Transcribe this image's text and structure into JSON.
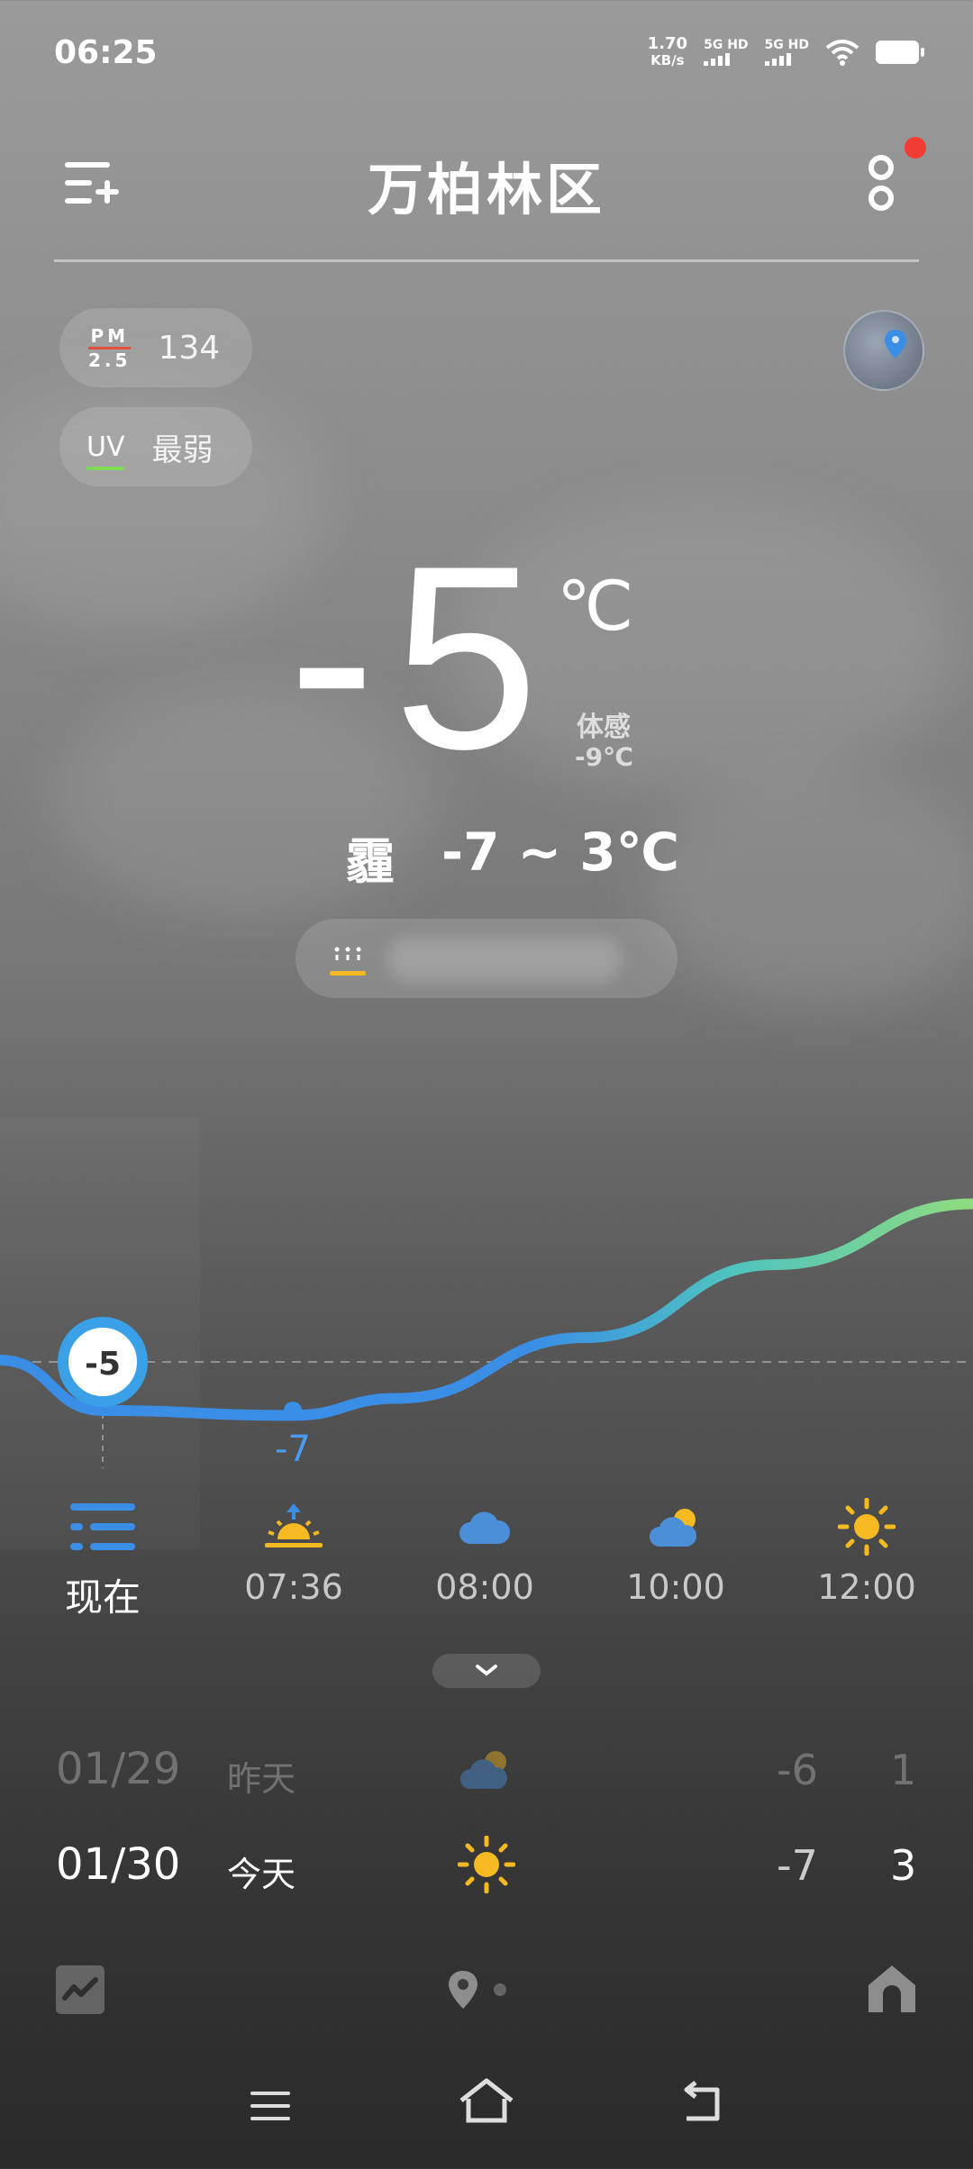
{
  "status_bar": {
    "time": "06:25",
    "net_speed_value": "1.70",
    "net_speed_unit": "KB/s",
    "sim1_label": "5G HD",
    "sim2_label": "5G HD"
  },
  "header": {
    "city": "万柏林区"
  },
  "air": {
    "pm_label_top": "PM",
    "pm_label_bottom": "2.5",
    "pm_value": "134",
    "uv_label": "UV",
    "uv_value": "最弱"
  },
  "current": {
    "temperature": "-5",
    "unit": "℃",
    "feels_like_label": "体感",
    "feels_like_value": "-9℃",
    "condition": "霾",
    "range": "-7 ~ 3℃"
  },
  "chart_data": {
    "type": "line",
    "now_marker": "-5",
    "min_label": "-7",
    "values": [
      -5,
      -7,
      -7.2,
      -6.5,
      -4,
      -1,
      1.5
    ]
  },
  "hourly": [
    {
      "label": "现在",
      "icon": "list-icon"
    },
    {
      "label": "07:36",
      "icon": "sunrise-icon"
    },
    {
      "label": "08:00",
      "icon": "cloud-icon"
    },
    {
      "label": "10:00",
      "icon": "partly-cloudy-icon"
    },
    {
      "label": "12:00",
      "icon": "sun-icon"
    }
  ],
  "daily": [
    {
      "date": "01/29",
      "name": "昨天",
      "icon": "partly-cloudy-icon",
      "low": "-6",
      "high": "1"
    },
    {
      "date": "01/30",
      "name": "今天",
      "icon": "sun-icon",
      "low": "-7",
      "high": "3"
    }
  ],
  "colors": {
    "accent_blue": "#3a8ee6",
    "sun_yellow": "#f5b921",
    "notify_red": "#f03c32",
    "uv_green": "#7ed957",
    "chart_gradient_end": "#8fdc7e"
  }
}
